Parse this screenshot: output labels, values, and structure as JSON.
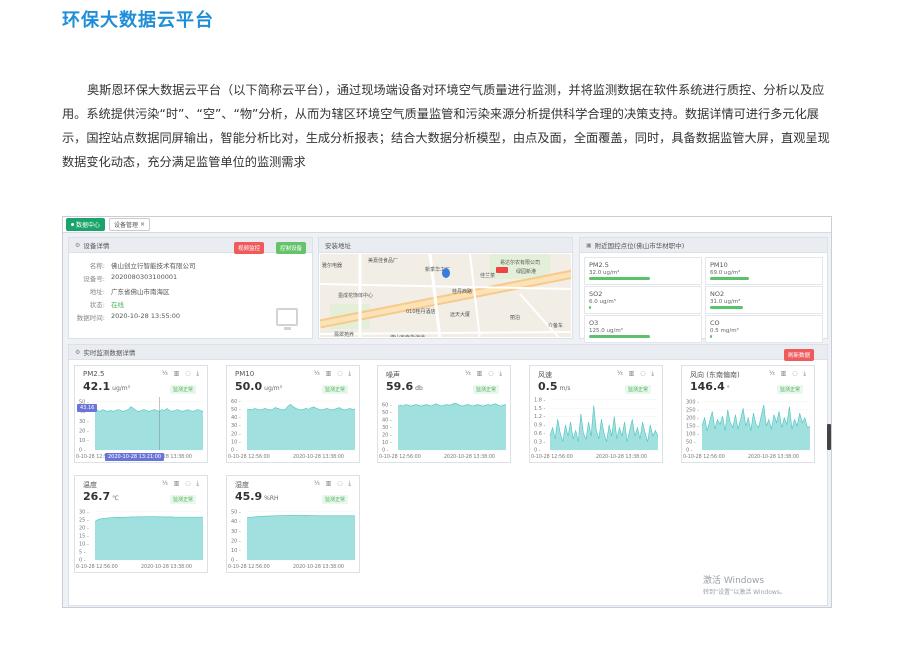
{
  "title": "环保大数据云平台",
  "intro": "奥斯恩环保大数据云平台（以下简称云平台），通过现场端设备对环境空气质量进行监测，并将监测数据在软件系统进行质控、分析以及应用。系统提供污染“时”、“空”、“物”分析，从而为辖区环境空气质量监管和污染来源分析提供科学合理的决策支持。数据详情可进行多元化展示，国控站点数据同屏输出，智能分析比对，生成分析报表；结合大数据分析模型，由点及面，全面覆盖，同时，具备数据监管大屏，直观呈现数据变化动态，充分满足监管单位的监测需求",
  "topbar": {
    "tab_home": "数据中心",
    "tab_device": "设备管理"
  },
  "device_panel": {
    "header": "设备详情",
    "btn_video": "视频监控",
    "btn_control": "控制设备",
    "rows": [
      {
        "key": "名称:",
        "value": "佛山创立行智能技术有限公司"
      },
      {
        "key": "设备号:",
        "value": "2020080303100001"
      },
      {
        "key": "地址:",
        "value": "广东省佛山市南海区"
      },
      {
        "key": "状态:",
        "value": "在线"
      },
      {
        "key": "数据时间:",
        "value": "2020-10-28 13:55:00"
      }
    ]
  },
  "map_panel": {
    "header": "安装地址",
    "labels": [
      "美嘉佳食品厂",
      "雅尔电器",
      "新季华工厂",
      "易达尔农有限公司",
      "绿园新港",
      "佳兰茶",
      "墨成花饰体中心",
      "桂丹西路",
      "010桂丹酒店",
      "远天大厦",
      "丽泊",
      "介备车",
      "翡翠苑养",
      "澳山布南华海道"
    ]
  },
  "guokong_panel": {
    "header": "附近国控点位(佛山市华材职中)",
    "items": [
      {
        "name": "PM2.5",
        "value": "32.0 ug/m³",
        "level": 0.55
      },
      {
        "name": "PM10",
        "value": "69.0 ug/m³",
        "level": 0.35
      },
      {
        "name": "SO2",
        "value": "6.0 ug/m³",
        "level": 0.02
      },
      {
        "name": "NO2",
        "value": "31.0 ug/m³",
        "level": 0.3
      },
      {
        "name": "O3",
        "value": "125.0 ug/m³",
        "level": 0.55
      },
      {
        "name": "CO",
        "value": "0.5 mg/m³",
        "level": 0.02
      }
    ]
  },
  "realtime_panel": {
    "header": "实时监测数据详情",
    "refresh": "刷新数据",
    "status": "监测正常",
    "tools": "⅓ ▥ ◌ ⤓",
    "x_start": "0-10-28 12:56:00",
    "x_end": "2020-10-28 13:38:00",
    "tooltip_value": "43.16",
    "tooltip_time": "2020-10-28 13:21:00"
  },
  "windows_watermark": {
    "line1": "激活 Windows",
    "line2": "转到“设置”以激活 Windows。"
  },
  "chart_data": [
    {
      "type": "area",
      "title": "PM2.5",
      "value_text": "42.1",
      "unit": "ug/m³",
      "yticks": [
        0,
        10,
        20,
        30,
        40,
        50
      ],
      "ylim": [
        0,
        55
      ],
      "values": [
        40,
        41,
        40,
        42,
        41,
        40,
        41,
        40,
        41,
        42,
        41,
        40,
        41,
        42,
        45,
        43,
        41,
        40,
        41,
        42,
        41,
        40,
        41,
        42,
        41,
        40,
        42,
        41,
        43,
        41,
        40,
        41,
        42,
        41,
        40,
        41,
        42,
        41,
        40,
        41,
        42,
        41,
        40
      ]
    },
    {
      "type": "area",
      "title": "PM10",
      "value_text": "50.0",
      "unit": "ug/m³",
      "yticks": [
        0,
        10,
        20,
        30,
        40,
        50,
        60
      ],
      "ylim": [
        0,
        65
      ],
      "values": [
        49,
        50,
        49,
        51,
        50,
        49,
        50,
        51,
        50,
        49,
        50,
        52,
        51,
        50,
        49,
        50,
        54,
        56,
        53,
        51,
        50,
        49,
        50,
        51,
        50,
        52,
        53,
        51,
        50,
        49,
        50,
        51,
        50,
        49,
        50,
        51,
        52,
        50,
        49,
        50,
        51,
        50,
        50
      ]
    },
    {
      "type": "area",
      "title": "噪声",
      "value_text": "59.6",
      "unit": "db",
      "yticks": [
        0,
        10,
        20,
        30,
        40,
        50,
        60
      ],
      "ylim": [
        0,
        70
      ],
      "values": [
        58,
        59,
        58,
        60,
        59,
        58,
        59,
        60,
        59,
        58,
        59,
        60,
        59,
        58,
        60,
        61,
        59,
        58,
        59,
        60,
        59,
        60,
        62,
        61,
        59,
        58,
        59,
        60,
        59,
        58,
        59,
        60,
        59,
        58,
        59,
        60,
        59,
        60,
        61,
        59,
        58,
        59,
        60
      ]
    },
    {
      "type": "area",
      "title": "风速",
      "value_text": "0.5",
      "unit": "m/s",
      "yticks": [
        0,
        0.3,
        0.6,
        0.9,
        1.2,
        1.5,
        1.8
      ],
      "ylim": [
        0,
        1.9
      ],
      "values": [
        0.5,
        0.8,
        0.4,
        1.1,
        0.6,
        0.3,
        0.9,
        0.5,
        1.0,
        0.4,
        0.7,
        0.3,
        1.3,
        0.6,
        0.4,
        1.0,
        0.5,
        1.6,
        0.7,
        0.4,
        1.1,
        0.6,
        0.3,
        0.9,
        0.5,
        1.2,
        0.4,
        0.8,
        0.5,
        1.0,
        0.3,
        0.7,
        1.1,
        0.5,
        0.8,
        0.4,
        1.0,
        0.6,
        0.3,
        0.9,
        0.5,
        0.7,
        0.5
      ]
    },
    {
      "type": "area",
      "title": "风向 (东南偏南)",
      "value_text": "146.4",
      "unit": "°",
      "yticks": [
        0,
        50,
        100,
        150,
        200,
        250,
        300
      ],
      "ylim": [
        0,
        330
      ],
      "values": [
        150,
        200,
        120,
        180,
        240,
        130,
        190,
        160,
        210,
        120,
        250,
        170,
        140,
        220,
        130,
        190,
        260,
        150,
        200,
        120,
        230,
        160,
        140,
        210,
        280,
        150,
        190,
        130,
        220,
        170,
        240,
        140,
        200,
        160,
        270,
        130,
        190,
        150,
        230,
        170,
        200,
        140,
        146
      ]
    },
    {
      "type": "area",
      "title": "温度",
      "value_text": "26.7",
      "unit": "℃",
      "yticks": [
        0,
        5,
        10,
        15,
        20,
        25,
        30
      ],
      "ylim": [
        0,
        33
      ],
      "values": [
        24,
        25,
        25.5,
        26,
        26,
        26.2,
        26.3,
        26.4,
        26.5,
        26.5,
        26.6,
        26.6,
        26.7,
        26.7,
        26.8,
        26.8,
        26.8,
        26.9,
        26.9,
        26.9,
        27,
        27,
        27,
        27,
        26.9,
        26.9,
        26.9,
        26.8,
        26.8,
        26.8,
        26.8,
        26.7,
        26.7,
        26.7,
        26.7,
        26.7,
        26.7,
        26.7,
        26.7,
        26.7,
        26.7,
        26.7,
        26.7
      ]
    },
    {
      "type": "area",
      "title": "湿度",
      "value_text": "45.9",
      "unit": "%RH",
      "yticks": [
        0,
        10,
        20,
        30,
        40,
        50
      ],
      "ylim": [
        0,
        55
      ],
      "values": [
        44,
        44.2,
        44.5,
        44.8,
        45,
        45.2,
        45.4,
        45.5,
        45.6,
        45.7,
        45.8,
        45.9,
        46,
        46,
        46.1,
        46.1,
        46.2,
        46.2,
        46.2,
        46.3,
        46.3,
        46.3,
        46.2,
        46.2,
        46.1,
        46.1,
        46,
        46,
        45.9,
        45.9,
        45.9,
        45.9,
        45.9,
        45.9,
        45.9,
        45.9,
        45.9,
        45.9,
        45.9,
        45.9,
        45.9,
        45.9,
        45.9
      ]
    }
  ]
}
